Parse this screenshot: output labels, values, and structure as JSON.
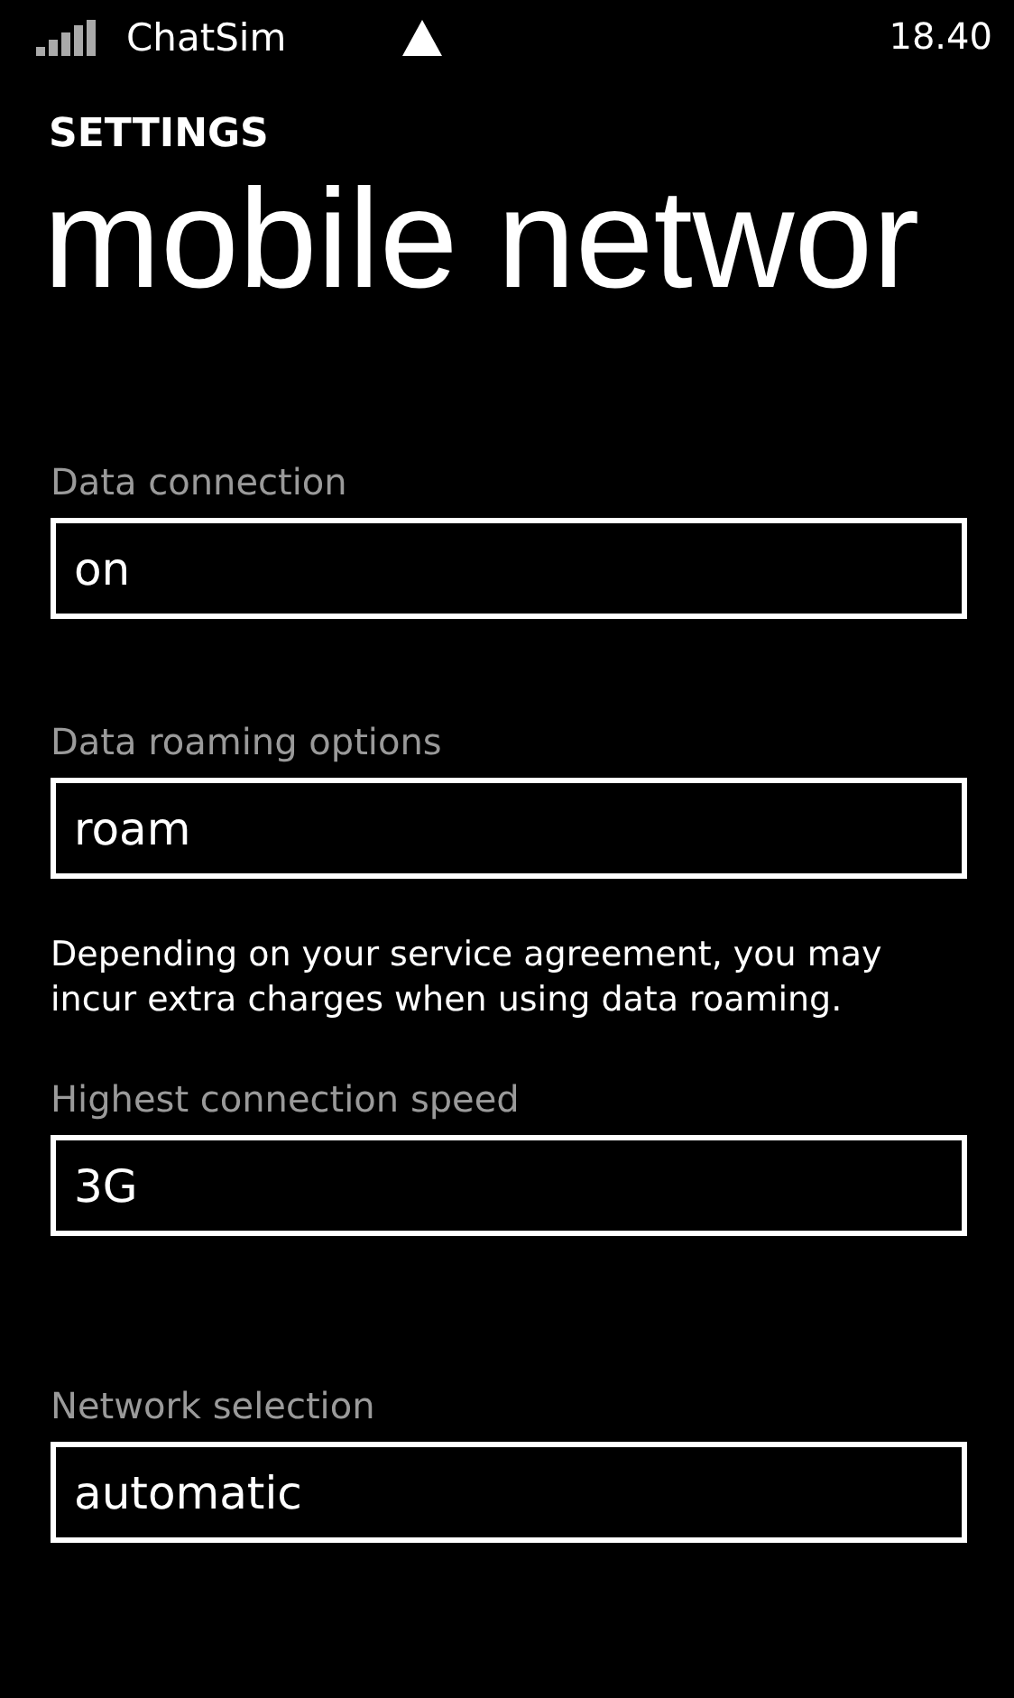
{
  "status_bar": {
    "carrier": "ChatSim",
    "time": "18.40"
  },
  "header": {
    "section": "SETTINGS",
    "title": "mobile networ"
  },
  "settings": [
    {
      "label": "Data connection",
      "value": "on"
    },
    {
      "label": "Data roaming options",
      "value": "roam",
      "note": "Depending on your service agreement, you may incur extra charges when using data roaming."
    },
    {
      "label": "Highest connection speed",
      "value": "3G"
    },
    {
      "label": "Network selection",
      "value": "automatic"
    }
  ]
}
